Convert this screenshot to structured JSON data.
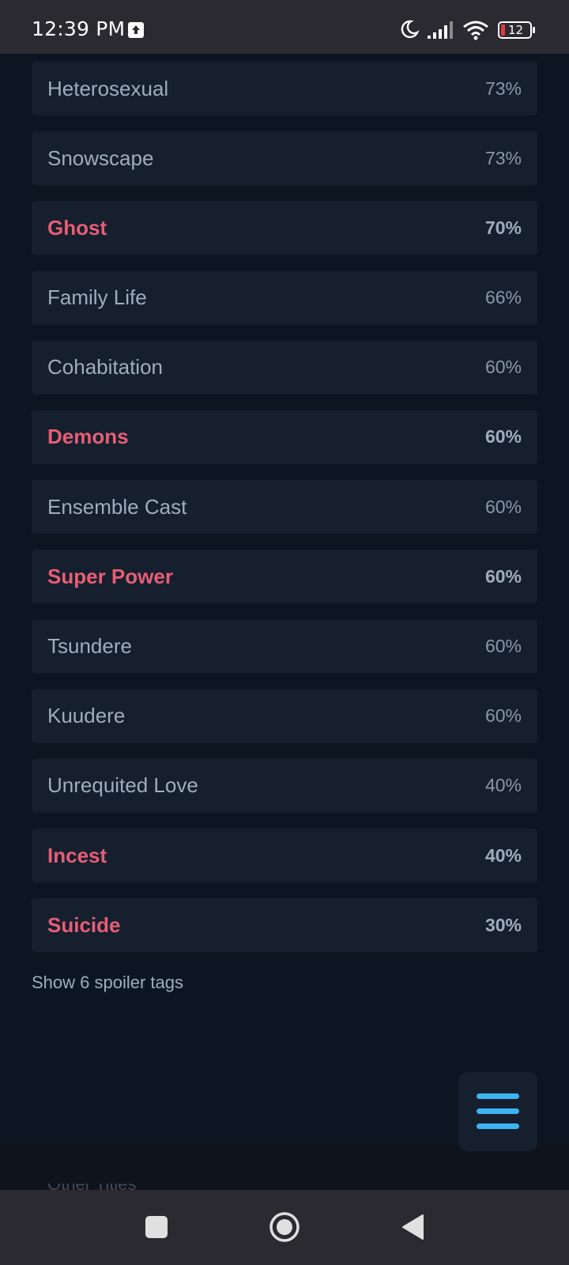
{
  "status_bar": {
    "time": "12:39 PM",
    "battery": "12"
  },
  "tags": [
    {
      "name": "Heterosexual",
      "score": "73%",
      "spoiler": false
    },
    {
      "name": "Snowscape",
      "score": "73%",
      "spoiler": false
    },
    {
      "name": "Ghost",
      "score": "70%",
      "spoiler": true
    },
    {
      "name": "Family Life",
      "score": "66%",
      "spoiler": false
    },
    {
      "name": "Cohabitation",
      "score": "60%",
      "spoiler": false
    },
    {
      "name": "Demons",
      "score": "60%",
      "spoiler": true
    },
    {
      "name": "Ensemble Cast",
      "score": "60%",
      "spoiler": false
    },
    {
      "name": "Super Power",
      "score": "60%",
      "spoiler": true
    },
    {
      "name": "Tsundere",
      "score": "60%",
      "spoiler": false
    },
    {
      "name": "Kuudere",
      "score": "60%",
      "spoiler": false
    },
    {
      "name": "Unrequited Love",
      "score": "40%",
      "spoiler": false
    },
    {
      "name": "Incest",
      "score": "40%",
      "spoiler": true
    },
    {
      "name": "Suicide",
      "score": "30%",
      "spoiler": true
    }
  ],
  "spoiler_toggle_label": "Show 6 spoiler tags",
  "cutoff_heading": "Other Titles",
  "colors": {
    "background": "#0b1622",
    "row_background": "#151f2e",
    "spoiler_text": "#e85d75",
    "accent": "#3db4f2"
  },
  "icons": {
    "fab": "hamburger-menu-icon",
    "nav": [
      "square-home-icon",
      "circle-recents-icon",
      "triangle-back-icon"
    ]
  }
}
